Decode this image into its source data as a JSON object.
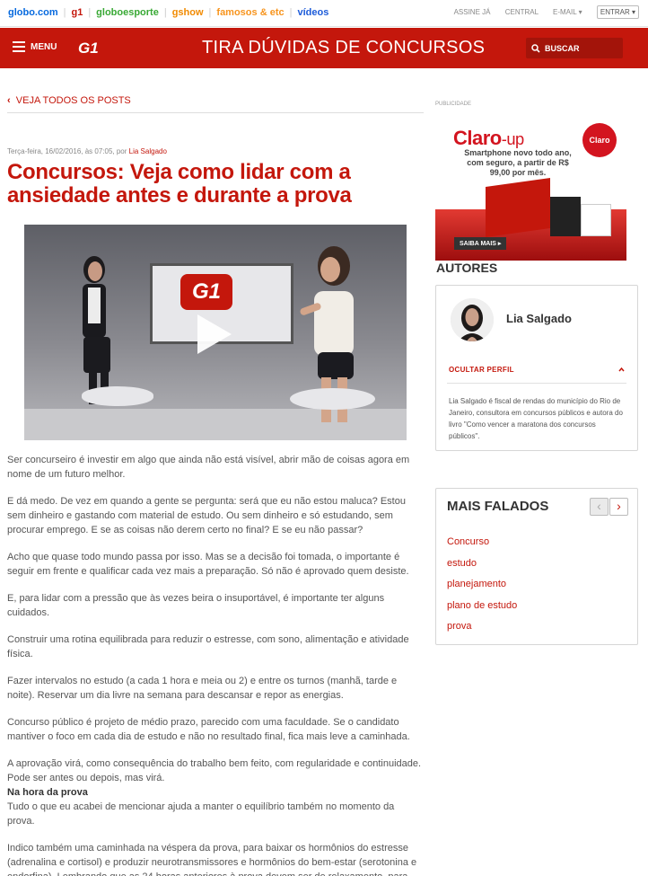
{
  "globo_bar": {
    "links": [
      "globo.com",
      "g1",
      "globoesporte",
      "gshow",
      "famosos & etc",
      "vídeos"
    ],
    "right_links": [
      "ASSINE JÁ",
      "CENTRAL",
      "E-MAIL ▾"
    ],
    "login": "ENTRAR ▾"
  },
  "colors": {
    "brand_red": "#c4170c",
    "globo_blue": "#0669de",
    "g1_red": "#c4170c",
    "globoesporte_green": "#39a935",
    "gshow_orange": "#f18a00",
    "famosos_orange": "#f7941d",
    "videos_blue": "#1c5bd9"
  },
  "header": {
    "menu_label": "MENU",
    "logo": "G1",
    "blog_title": "TIRA DÚVIDAS DE CONCURSOS",
    "search_label": "BUSCAR"
  },
  "article": {
    "back_link": "VEJA TODOS OS POSTS",
    "meta_date": "Terça-feira, 16/02/2016, às 07:05, por",
    "meta_author": "Lia Salgado",
    "title": "Concursos: Veja como lidar com a ansiedade antes e durante a prova",
    "video_logo": "G1",
    "paragraphs": [
      "Ser concurseiro é investir em algo que ainda não está visível, abrir mão de coisas agora em nome de um futuro melhor.",
      "E dá medo. De vez em quando a gente se pergunta: será que eu não estou maluca? Estou sem dinheiro e gastando com material de estudo. Ou sem dinheiro e só estudando, sem procurar emprego. E se as coisas não derem certo no final? E se eu não passar?",
      "Acho que quase todo mundo passa por isso. Mas se a decisão foi tomada, o importante é seguir em frente e qualificar cada vez mais a preparação. Só não é aprovado quem desiste.",
      "E, para lidar com a pressão que às vezes beira o insuportável, é importante ter alguns cuidados.",
      "Construir uma rotina equilibrada para reduzir o estresse, com sono, alimentação e atividade física.",
      "Fazer intervalos no estudo (a cada 1 hora e meia ou 2) e entre os turnos (manhã, tarde e noite). Reservar um dia livre na semana para descansar e repor as energias.",
      "Concurso público é projeto de médio prazo, parecido com uma faculdade. Se o candidato mantiver o foco em cada dia de estudo e não no resultado final, fica mais leve a caminhada.",
      "A aprovação virá, como consequência do trabalho bem feito, com regularidade e continuidade. Pode ser antes ou depois, mas virá."
    ],
    "subheading": "Na hora da prova",
    "paragraphs2": [
      "Tudo o que eu acabei de mencionar ajuda a manter o equilíbrio também no momento da prova.",
      "Indico também uma caminhada na véspera da prova, para baixar os hormônios do estresse (adrenalina e cortisol) e produzir neurotransmissores e hormônios do bem-estar (serotonina e endorfina). Lembrando que as 24 horas anteriores à prova devem ser de relaxamento, para"
    ]
  },
  "ad": {
    "label": "PUBLICIDADE",
    "brand": "Claro",
    "product": "-up",
    "logo_text": "Claro",
    "text": "Smartphone novo todo ano, com seguro, a partir de R$ 99,00 por mês.",
    "cta": "SAIBA MAIS ▸"
  },
  "autores": {
    "title": "AUTORES",
    "name": "Lia Salgado",
    "toggle_label": "OCULTAR PERFIL",
    "bio": "Lia Salgado é fiscal de rendas do município do Rio de Janeiro, consultora em concursos públicos e autora do livro \"Como vencer a maratona dos concursos públicos\"."
  },
  "mais_falados": {
    "title": "MAIS FALADOS",
    "prev": "‹",
    "next": "›",
    "items": [
      "Concurso",
      "estudo",
      "planejamento",
      "plano de estudo",
      "prova"
    ]
  }
}
